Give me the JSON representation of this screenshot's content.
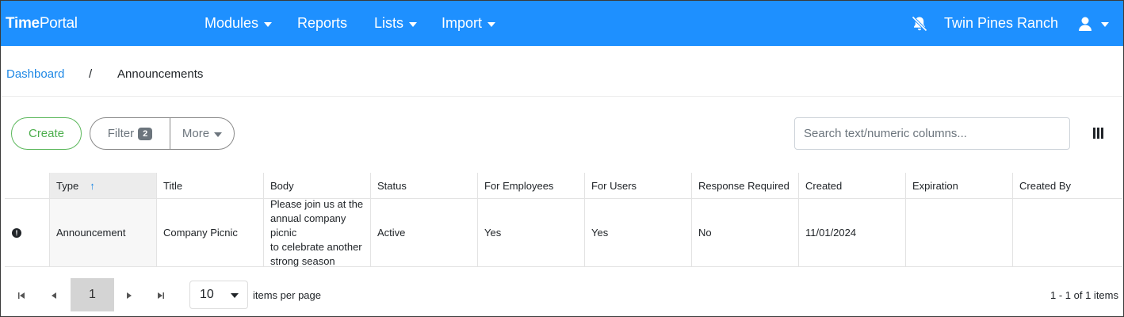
{
  "app": {
    "brand_bold": "Time",
    "brand_rest": "Portal"
  },
  "nav": {
    "items": [
      {
        "label": "Modules",
        "dropdown": true
      },
      {
        "label": "Reports",
        "dropdown": false
      },
      {
        "label": "Lists",
        "dropdown": true
      },
      {
        "label": "Import",
        "dropdown": true
      }
    ],
    "org_name": "Twin Pines Ranch",
    "bell_icon": "bell-slash-icon",
    "user_icon": "user-icon"
  },
  "breadcrumb": {
    "root": "Dashboard",
    "separator": "/",
    "current": "Announcements"
  },
  "toolbar": {
    "create_label": "Create",
    "filter_label": "Filter",
    "filter_count": "2",
    "more_label": "More",
    "search_placeholder": "Search text/numeric columns...",
    "columns_icon": "column-chooser-icon"
  },
  "table": {
    "columns": [
      "Type",
      "Title",
      "Body",
      "Status",
      "For Employees",
      "For Users",
      "Response Required",
      "Created",
      "Expiration",
      "Created By"
    ],
    "sort_column": "Type",
    "sort_direction": "ascending",
    "rows": [
      {
        "icon": "!",
        "cells": [
          "Announcement",
          "Company Picnic",
          "Please join us at the\nannual company picnic\nto celebrate another\nstrong season",
          "Active",
          "Yes",
          "Yes",
          "No",
          "11/01/2024",
          "",
          ""
        ]
      }
    ]
  },
  "pager": {
    "current_page": "1",
    "page_size": "10",
    "items_per_page_label": "items per page",
    "range_text": "1 - 1 of 1 items"
  },
  "colors": {
    "navbar": "#1e90ff",
    "create": "#4cae4c",
    "link": "#1e88e5"
  }
}
